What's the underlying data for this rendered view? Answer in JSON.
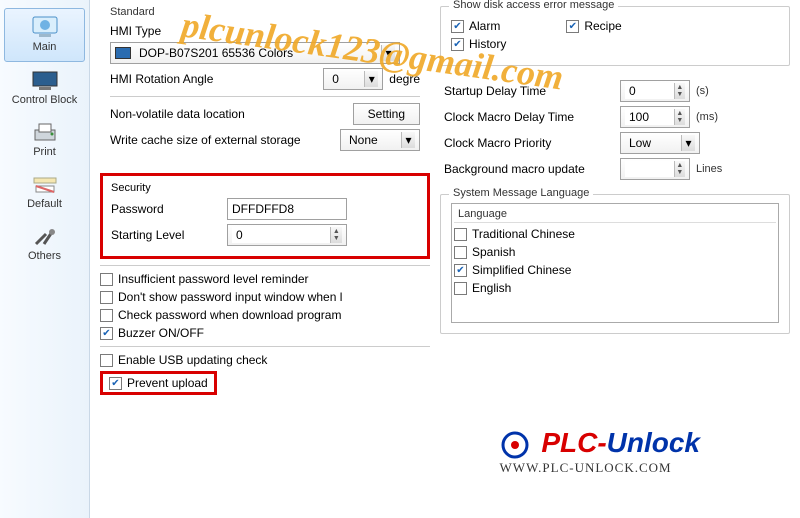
{
  "sidebar": {
    "items": [
      {
        "label": "Main"
      },
      {
        "label": "Control Block"
      },
      {
        "label": "Print"
      },
      {
        "label": "Default"
      },
      {
        "label": "Others"
      }
    ]
  },
  "standard": {
    "legend": "Standard",
    "hmiTypeLabel": "HMI Type",
    "hmiTypeValue": "DOP-B07S201 65536 Colors",
    "rotationLabel": "HMI Rotation Angle",
    "rotationValue": "0",
    "rotationUnit": "degre",
    "nvLocationLabel": "Non-volatile data location",
    "settingBtn": "Setting",
    "cacheLabel": "Write cache size of external storage",
    "cacheValue": "None"
  },
  "security": {
    "legend": "Security",
    "passwordLabel": "Password",
    "passwordValue": "DFFDFFD8",
    "startLevelLabel": "Starting Level",
    "startLevelValue": "0"
  },
  "options": {
    "insufficient": "Insufficient password level reminder",
    "dontShow": "Don't show password input window when l",
    "checkPw": "Check password when download program",
    "buzzer": "Buzzer ON/OFF",
    "enableUSB": "Enable USB updating check",
    "preventUpload": "Prevent upload"
  },
  "diskErr": {
    "legend": "Show disk access error message",
    "alarm": "Alarm",
    "recipe": "Recipe",
    "history": "History"
  },
  "timing": {
    "startupLabel": "Startup Delay Time",
    "startupVal": "0",
    "startupUnit": "(s)",
    "clockDelayLabel": "Clock Macro Delay Time",
    "clockDelayVal": "100",
    "clockDelayUnit": "(ms)",
    "clockPrioLabel": "Clock Macro Priority",
    "clockPrioVal": "Low",
    "bgMacroLabel": "Background macro update",
    "bgMacroVal": "",
    "bgMacroUnit": "Lines"
  },
  "lang": {
    "legend": "System Message Language",
    "header": "Language",
    "items": [
      {
        "label": "Traditional Chinese",
        "checked": false
      },
      {
        "label": "Spanish",
        "checked": false
      },
      {
        "label": "Simplified Chinese",
        "checked": true
      },
      {
        "label": "English",
        "checked": false
      }
    ]
  },
  "watermark": {
    "email": "plcunlock123@gmail.com",
    "brand1": "PLC-",
    "brand2": "Unlock",
    "site": "WWW.PLC-UNLOCK.COM"
  }
}
